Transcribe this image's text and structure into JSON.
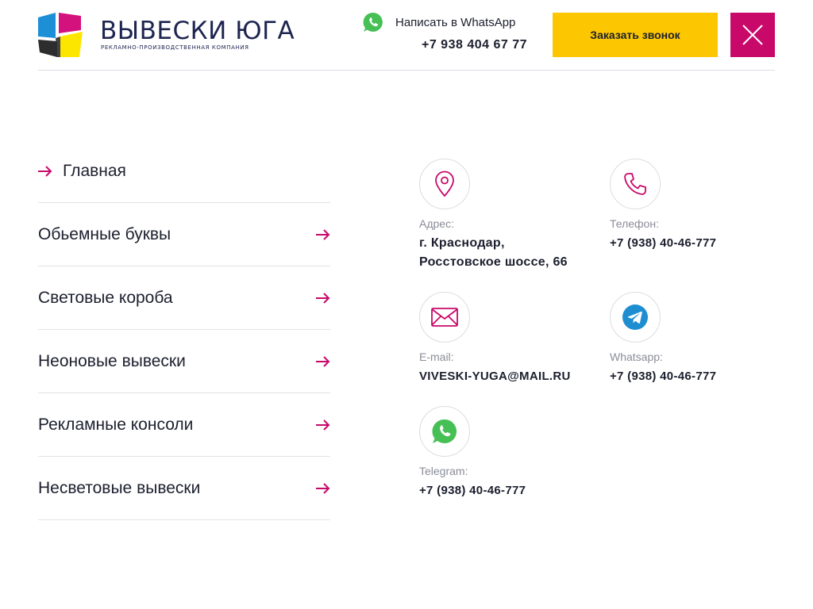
{
  "brand": {
    "title": "ВЫВЕСКИ ЮГА",
    "subtitle": "рекламно-производственная компания",
    "colors": {
      "blue": "#1d8fd6",
      "pink": "#d4127d",
      "yellow": "#fce600",
      "dark": "#2d2d2d",
      "navy": "#1e2550"
    }
  },
  "header": {
    "whatsapp_label": "Написать в WhatsApp",
    "phone": "+7 938 404 67 77",
    "callback_label": "Заказать звонок",
    "close_icon": "close-icon",
    "accent_yellow": "#fcc601",
    "accent_pink": "#c8096a"
  },
  "nav": {
    "items": [
      {
        "label": "Главная"
      },
      {
        "label": "Обьемные буквы"
      },
      {
        "label": "Световые короба"
      },
      {
        "label": "Неоновые вывески"
      },
      {
        "label": "Рекламные консоли"
      },
      {
        "label": "Несветовые вывески"
      }
    ]
  },
  "contacts": {
    "address": {
      "icon": "location-pin-icon",
      "label": "Адрес:",
      "line1": "г. Краснодар,",
      "line2": "Росстовское шоссе, 66"
    },
    "phone": {
      "icon": "phone-icon",
      "label": "Телефон:",
      "value": "+7 (938) 40-46-777"
    },
    "email": {
      "icon": "envelope-icon",
      "label": "E-mail:",
      "value": "VIVESKI-YUGA@MAIL.RU"
    },
    "whatsapp": {
      "icon": "telegram-icon",
      "label": "Whatsapp:",
      "value": "+7 (938) 40-46-777"
    },
    "telegram": {
      "icon": "whatsapp-icon",
      "label": "Telegram:",
      "value": "+7 (938) 40-46-777"
    }
  }
}
